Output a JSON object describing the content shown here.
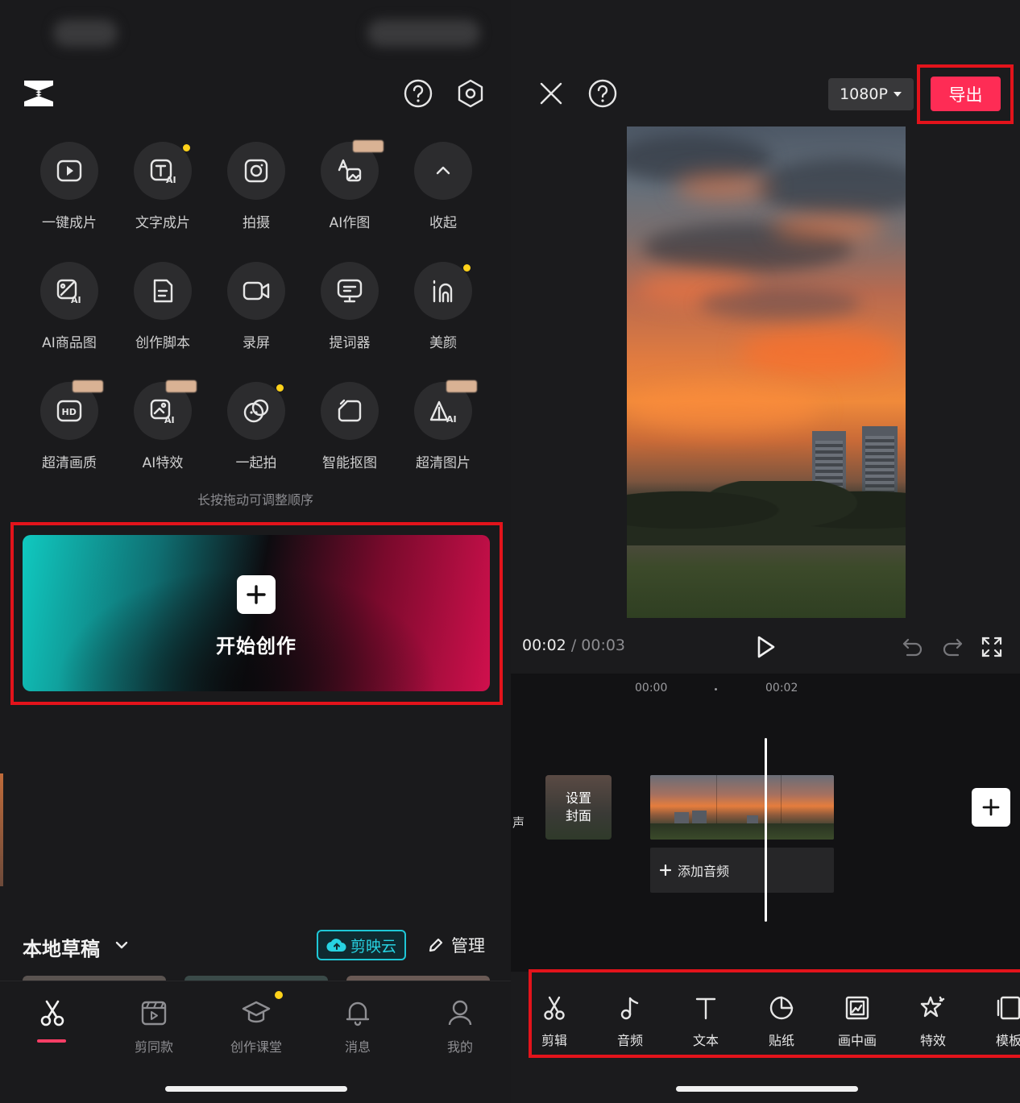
{
  "left_screen": {
    "icons": {
      "logo": "capcut-logo",
      "help": "question-circle-icon",
      "settings": "hexagon-gear-icon"
    },
    "tools": [
      {
        "label": "一键成片",
        "icon": "play-square-icon",
        "badge": "none"
      },
      {
        "label": "文字成片",
        "icon": "text-ai-icon",
        "badge": "dot"
      },
      {
        "label": "拍摄",
        "icon": "camera-icon",
        "badge": "none"
      },
      {
        "label": "AI作图",
        "icon": "ai-image-icon",
        "badge": "tag"
      },
      {
        "label": "收起",
        "icon": "chevron-up-icon",
        "badge": "none"
      },
      {
        "label": "AI商品图",
        "icon": "ai-product-icon",
        "badge": "none"
      },
      {
        "label": "创作脚本",
        "icon": "script-doc-icon",
        "badge": "none"
      },
      {
        "label": "录屏",
        "icon": "video-record-icon",
        "badge": "none"
      },
      {
        "label": "提词器",
        "icon": "teleprompter-icon",
        "badge": "none"
      },
      {
        "label": "美颜",
        "icon": "beauty-icon",
        "badge": "dot"
      },
      {
        "label": "超清画质",
        "icon": "hd-icon",
        "badge": "tag"
      },
      {
        "label": "AI特效",
        "icon": "ai-effect-icon",
        "badge": "tag"
      },
      {
        "label": "一起拍",
        "icon": "duet-icon",
        "badge": "dot"
      },
      {
        "label": "智能抠图",
        "icon": "cutout-icon",
        "badge": "none"
      },
      {
        "label": "超清图片",
        "icon": "hd-image-icon",
        "badge": "tag"
      }
    ],
    "hint": "长按拖动可调整顺序",
    "create_button": "开始创作",
    "drafts": {
      "title": "本地草稿",
      "cloud_label": "剪映云",
      "manage_label": "管理"
    },
    "tabs": [
      {
        "label": "",
        "icon": "scissors-icon",
        "active": true
      },
      {
        "label": "剪同款",
        "icon": "template-clapper-icon",
        "active": false
      },
      {
        "label": "创作课堂",
        "icon": "graduation-cap-icon",
        "active": false
      },
      {
        "label": "消息",
        "icon": "bell-icon",
        "active": false
      },
      {
        "label": "我的",
        "icon": "user-icon",
        "active": false
      }
    ],
    "colors": {
      "accent": "#fe2c55",
      "dot": "#ffd21a",
      "cloud": "#27d3e2",
      "highlight": "#e3131b"
    }
  },
  "right_screen": {
    "resolution": "1080P",
    "export_label": "导出",
    "current_time": "00:02",
    "separator": "/",
    "total_time": "00:03",
    "ruler": [
      "00:00",
      "00:02"
    ],
    "side_label": "声",
    "cover_label_1": "设置",
    "cover_label_2": "封面",
    "add_audio": "添加音频",
    "toolbar": [
      {
        "label": "剪辑",
        "icon": "scissors-icon"
      },
      {
        "label": "音频",
        "icon": "music-note-icon"
      },
      {
        "label": "文本",
        "icon": "text-t-icon"
      },
      {
        "label": "贴纸",
        "icon": "sticker-icon"
      },
      {
        "label": "画中画",
        "icon": "picture-in-picture-icon"
      },
      {
        "label": "特效",
        "icon": "effects-star-icon"
      },
      {
        "label": "模板",
        "icon": "template-icon"
      }
    ]
  }
}
